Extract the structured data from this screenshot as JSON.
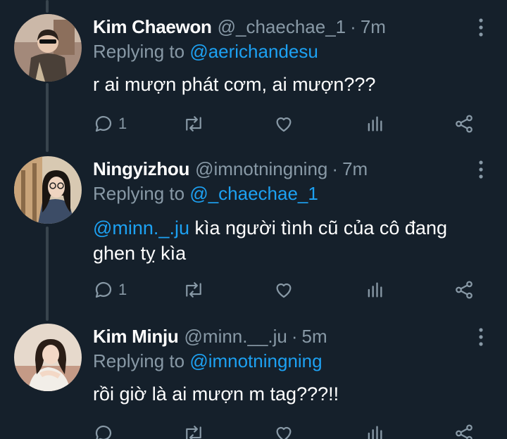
{
  "tweets": [
    {
      "display_name": "Kim Chaewon",
      "handle": "@_chaechae_1",
      "separator": "·",
      "time": "7m",
      "replying_prefix": "Replying to",
      "replying_to": "@aerichandesu",
      "text": "r ai mượn phát cơm, ai mượn???",
      "mention": "",
      "reply_count": "1",
      "avatar_icon": "avatar-photo-icon"
    },
    {
      "display_name": "Ningyizhou",
      "handle": "@imnotningning",
      "separator": "·",
      "time": "7m",
      "replying_prefix": "Replying to",
      "replying_to": "@_chaechae_1",
      "mention": "@minn._.ju",
      "text": " kìa người tình cũ của cô đang ghen tỵ kìa",
      "reply_count": "1",
      "avatar_icon": "avatar-photo-icon"
    },
    {
      "display_name": "Kim Minju",
      "handle": "@minn.__.ju",
      "separator": "·",
      "time": "5m",
      "replying_prefix": "Replying to",
      "replying_to": "@imnotningning",
      "text": "rồi giờ là ai mượn m tag???!!",
      "mention": "",
      "reply_count": "",
      "avatar_icon": "avatar-photo-icon"
    }
  ],
  "icons": {
    "reply": "reply-icon",
    "retweet": "retweet-icon",
    "like": "like-icon",
    "analytics": "analytics-icon",
    "share": "share-icon",
    "more": "more-options-icon"
  },
  "colors": {
    "background": "#15202b",
    "text": "#ffffff",
    "muted": "#8899a6",
    "accent": "#1da1f2",
    "thread_line": "#38444d"
  }
}
